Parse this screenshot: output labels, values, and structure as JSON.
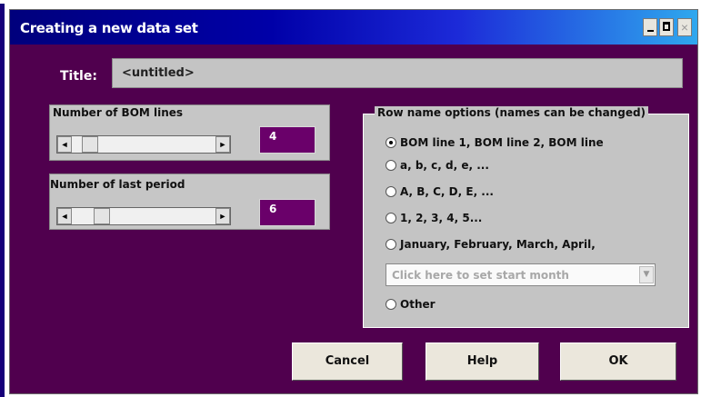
{
  "window": {
    "title": "Creating a new data set",
    "controls": {
      "minimize_icon": "minimize-icon",
      "maximize_icon": "maximize-icon",
      "close_label": "×"
    }
  },
  "title_field": {
    "label": "Title:",
    "value": "<untitled>"
  },
  "bom_lines": {
    "label": "Number of BOM lines",
    "value": "4",
    "slider_level": 0.08
  },
  "last_period": {
    "label": "Number of last period",
    "value": "6",
    "slider_level": 0.17
  },
  "row_names": {
    "legend": "Row name options (names can be changed)",
    "options": [
      {
        "label": "BOM line 1, BOM line 2, BOM line",
        "checked": true
      },
      {
        "label": "a, b, c, d, e, ...",
        "checked": false
      },
      {
        "label": "A, B, C, D, E, ...",
        "checked": false
      },
      {
        "label": "1, 2, 3, 4, 5...",
        "checked": false
      },
      {
        "label": "January, February, March, April,",
        "checked": false
      }
    ],
    "month_placeholder": "Click here to set start month",
    "other_label": "Other"
  },
  "buttons": {
    "cancel": "Cancel",
    "help": "Help",
    "ok": "OK"
  },
  "icons": {
    "scroll_left": "◄",
    "scroll_right": "►",
    "dropdown": "▼"
  },
  "colors": {
    "background": "#50004e",
    "titlebar_start": "#00007c",
    "titlebar_end": "#2fa8ee",
    "value_box": "#6a006a"
  }
}
